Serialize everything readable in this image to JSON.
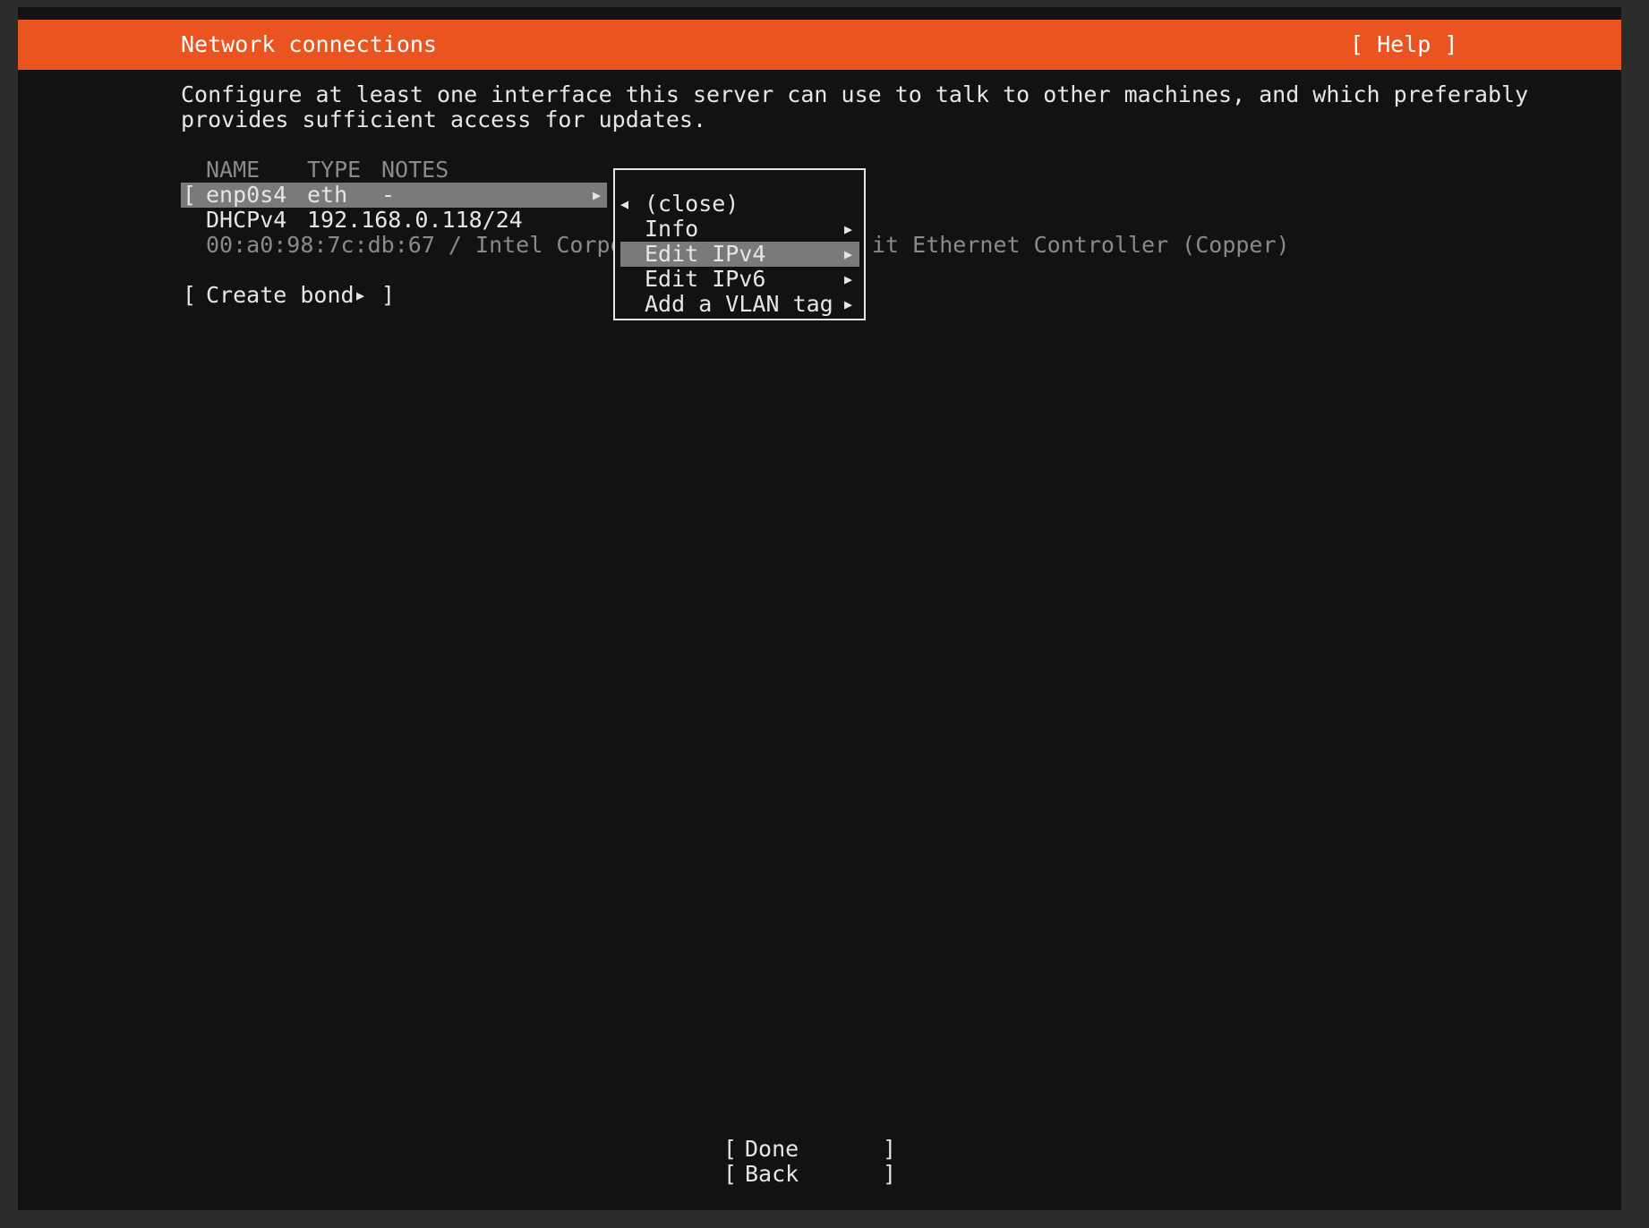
{
  "header": {
    "title": "Network connections",
    "help_label": "[ Help ]"
  },
  "description": {
    "line1": "Configure at least one interface this server can use to talk to other machines, and which preferably",
    "line2": "provides sufficient access for updates."
  },
  "table": {
    "columns": [
      "NAME",
      "TYPE",
      "NOTES"
    ],
    "interfaces": [
      {
        "name": "enp0s4",
        "type": "eth",
        "notes": "-",
        "dhcp_label": "DHCPv4",
        "address": "192.168.0.118/24",
        "hw_info_left": "00:a0:98:7c:db:67 / Intel Corpor",
        "hw_info_right": "it Ethernet Controller (Copper)"
      }
    ]
  },
  "create_bond_label": "Create bond",
  "context_menu": {
    "items": [
      {
        "label": "(close)",
        "icon": "triangle-left-icon"
      },
      {
        "label": "Info",
        "icon": "triangle-right-icon"
      },
      {
        "label": "Edit IPv4",
        "icon": "triangle-right-icon",
        "selected": true
      },
      {
        "label": "Edit IPv6",
        "icon": "triangle-right-icon"
      },
      {
        "label": "Add a VLAN tag",
        "icon": "triangle-right-icon"
      }
    ]
  },
  "footer": {
    "done_label": "Done",
    "back_label": "Back"
  },
  "colors": {
    "accent": "#e95420",
    "background": "#121212",
    "highlight": "#7a7a7a"
  }
}
